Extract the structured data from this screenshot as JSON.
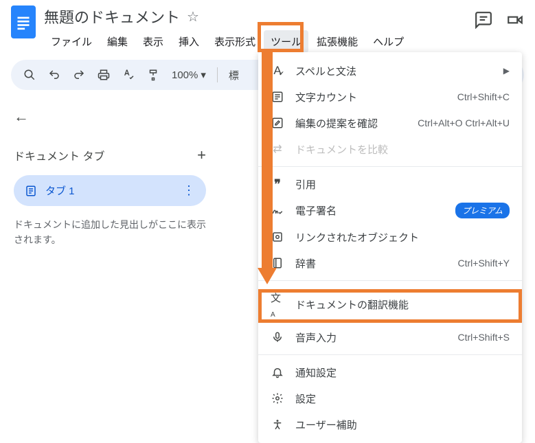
{
  "header": {
    "title": "無題のドキュメント",
    "menus": [
      "ファイル",
      "編集",
      "表示",
      "挿入",
      "表示形式",
      "ツール",
      "拡張機能",
      "ヘルプ"
    ],
    "active_menu_index": 5
  },
  "toolbar": {
    "zoom": "100%",
    "style_text": "標"
  },
  "sidebar": {
    "tabs_title": "ドキュメント タブ",
    "tab_label": "タブ 1",
    "hint": "ドキュメントに追加した見出しがここに表示されます。"
  },
  "dropdown": {
    "items": [
      {
        "icon": "A",
        "label": "スペルと文法",
        "arrow": true
      },
      {
        "icon": "list",
        "label": "文字カウント",
        "shortcut": "Ctrl+Shift+C"
      },
      {
        "icon": "edit",
        "label": "編集の提案を確認",
        "shortcut": "Ctrl+Alt+O Ctrl+Alt+U"
      },
      {
        "icon": "compare",
        "label": "ドキュメントを比較",
        "disabled": true
      },
      {
        "sep": true
      },
      {
        "icon": "quote",
        "label": "引用"
      },
      {
        "icon": "sign",
        "label": "電子署名",
        "badge": "プレミアム"
      },
      {
        "icon": "link",
        "label": "リンクされたオブジェクト"
      },
      {
        "icon": "dict",
        "label": "辞書",
        "shortcut": "Ctrl+Shift+Y"
      },
      {
        "sep": true
      },
      {
        "icon": "translate",
        "label": "ドキュメントの翻訳機能"
      },
      {
        "icon": "mic",
        "label": "音声入力",
        "shortcut": "Ctrl+Shift+S"
      },
      {
        "sep": true
      },
      {
        "icon": "bell",
        "label": "通知設定"
      },
      {
        "icon": "gear",
        "label": "設定"
      },
      {
        "icon": "access",
        "label": "ユーザー補助"
      }
    ]
  }
}
